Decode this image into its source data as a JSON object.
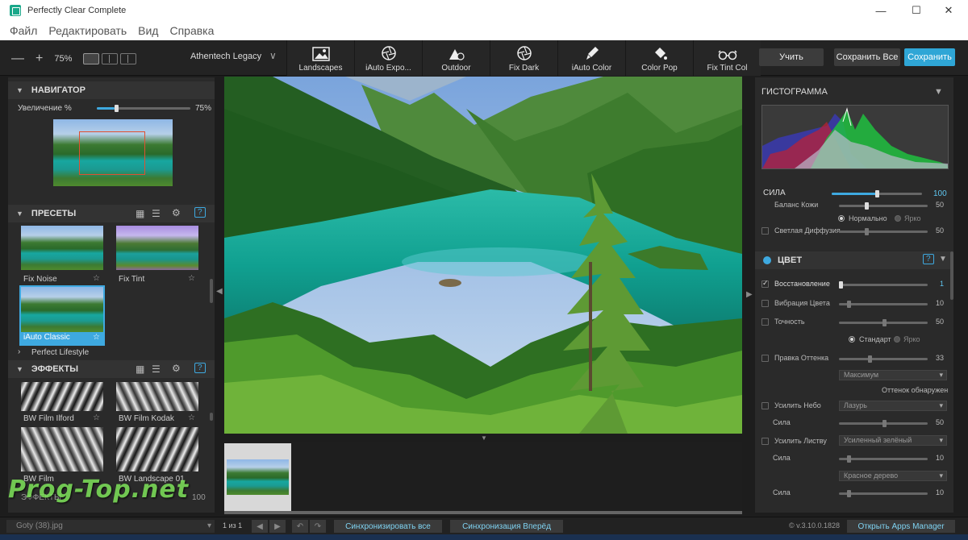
{
  "window": {
    "title": "Perfectly Clear Complete"
  },
  "menu": [
    "Файл",
    "Редактировать",
    "Вид",
    "Справка"
  ],
  "toolbar": {
    "zoom": "75%",
    "preset_selected": "Athentech Legacy",
    "tools": [
      "Landscapes",
      "iAuto Expo...",
      "Outdoor",
      "Fix Dark",
      "iAuto Color",
      "Color Pop",
      "Fix Tint Col"
    ],
    "learn_label": "Учить",
    "save_all_label": "Сохранить Все",
    "save_label": "Сохранить"
  },
  "navigator": {
    "title": "НАВИГАТОР",
    "zoom_label": "Увеличение %",
    "zoom_value": "75%",
    "zoom_level": 0.75
  },
  "presets": {
    "title": "ПРЕСЕТЫ",
    "items": [
      {
        "label": "Fix Noise"
      },
      {
        "label": "Fix Tint"
      },
      {
        "label": "iAuto Classic"
      }
    ],
    "group": "Perfect Lifestyle"
  },
  "effects": {
    "title": "ЭФФЕКТЫ",
    "items": [
      {
        "label": "BW Film Ilford"
      },
      {
        "label": "BW Film Kodak"
      },
      {
        "label": "BW Film"
      },
      {
        "label": "BW Landscape 01"
      }
    ],
    "footer_label": "ЭФФЕКТЫ",
    "footer_value": "100"
  },
  "right": {
    "histogram_title": "ГИСТОГРАММА",
    "strength_label": "СИЛА",
    "strength_value": "100",
    "skin_balance": "Баланс Кожи",
    "skin_value": "50",
    "normal": "Нормально",
    "bright": "Ярко",
    "diffusion_label": "Светлая Диффузия",
    "diffusion_value": "50",
    "color_section": "ЦВЕТ",
    "rows": {
      "restore": {
        "label": "Восстановление",
        "value": "1"
      },
      "vibrancy": {
        "label": "Вибрация Цвета",
        "value": "10"
      },
      "accuracy": {
        "label": "Точность",
        "value": "50"
      },
      "standard": "Стандарт",
      "bright2": "Ярко",
      "tint_fix": {
        "label": "Правка Оттенка",
        "value": "33"
      },
      "max_option": "Максимум",
      "tint_detected": "Оттенок обнаружен",
      "sky": {
        "label": "Усилить Небо",
        "option": "Лазурь"
      },
      "sky_strength": {
        "label": "Сила",
        "value": "50"
      },
      "foliage": {
        "label": "Усилить Листву",
        "option": "Усиленный зелёный"
      },
      "foliage_strength": {
        "label": "Сила",
        "value": "10"
      },
      "wood_option": "Красное дерево",
      "wood_strength": {
        "label": "Сила",
        "value": "10"
      }
    }
  },
  "statusbar": {
    "filename": "Goty (38).jpg",
    "page": "1 из 1",
    "sync_all": "Синхронизировать все",
    "sync_forward": "Синхронизация Вперёд",
    "version": "© v.3.10.0.1828",
    "open_apps": "Открыть Apps Manager"
  },
  "watermark": "Prog-Top.net",
  "colors": {
    "accent": "#2fa6d6",
    "panel": "#2a2a2a"
  }
}
